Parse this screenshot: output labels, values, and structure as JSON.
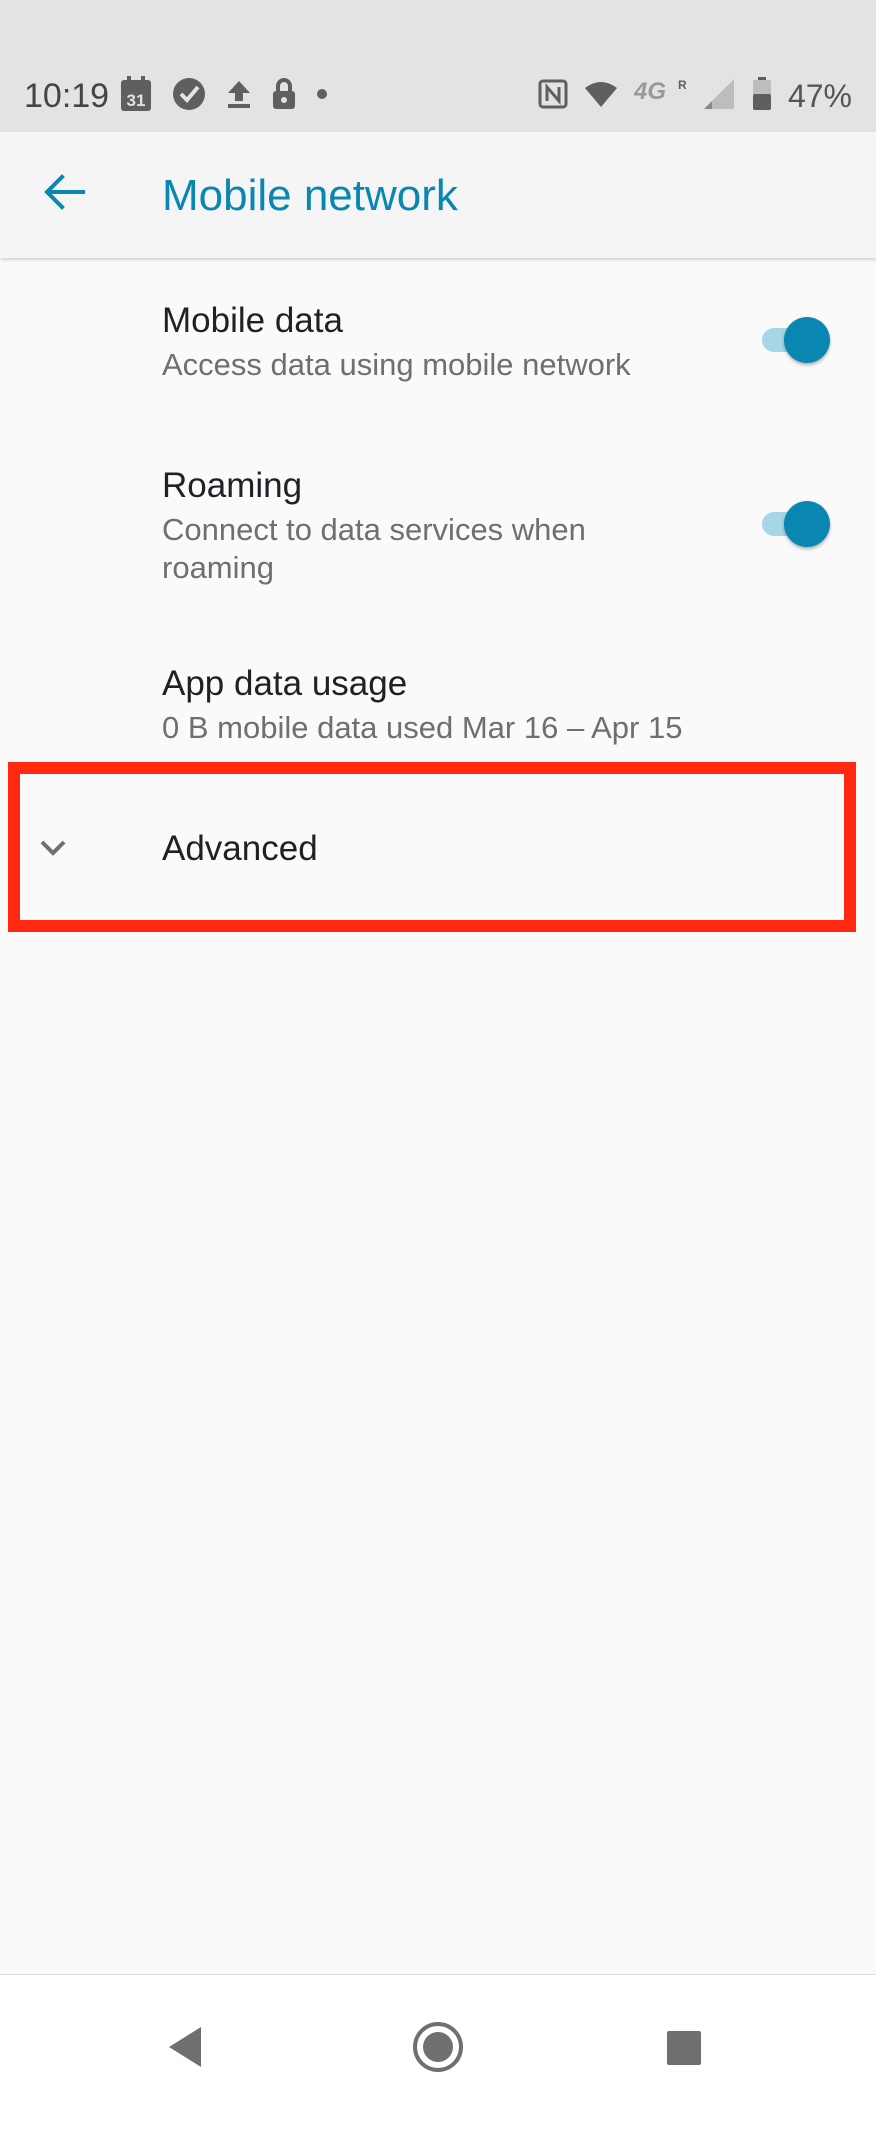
{
  "status_bar": {
    "time": "10:19",
    "calendar_day": "31",
    "battery_percent": "47%",
    "network_type": "4G",
    "roaming_indicator": "R",
    "left_icons": [
      "calendar-icon",
      "check-circle-icon",
      "upload-icon",
      "lock-icon",
      "dot-icon"
    ],
    "right_icons": [
      "nfc-icon",
      "wifi-icon",
      "network-4g-icon",
      "signal-icon",
      "battery-icon"
    ]
  },
  "app_bar": {
    "title": "Mobile network",
    "back_icon": "arrow-back-icon"
  },
  "preferences": [
    {
      "title": "Mobile data",
      "summary": "Access data using mobile network",
      "toggle_on": true
    },
    {
      "title": "Roaming",
      "summary_line1": "Connect to data services when",
      "summary_line2": "roaming",
      "toggle_on": true
    },
    {
      "title": "App data usage",
      "summary": "0 B mobile data used Mar 16 – Apr 15"
    }
  ],
  "advanced": {
    "label": "Advanced",
    "icon": "chevron-down-icon"
  },
  "nav_bar": {
    "buttons": [
      "back-icon",
      "home-icon",
      "recents-icon"
    ]
  },
  "colors": {
    "accent": "#0a87b0",
    "toggle_track": "#a7d7e6",
    "highlight_box": "#ff2a0f",
    "background": "#fafafa"
  }
}
